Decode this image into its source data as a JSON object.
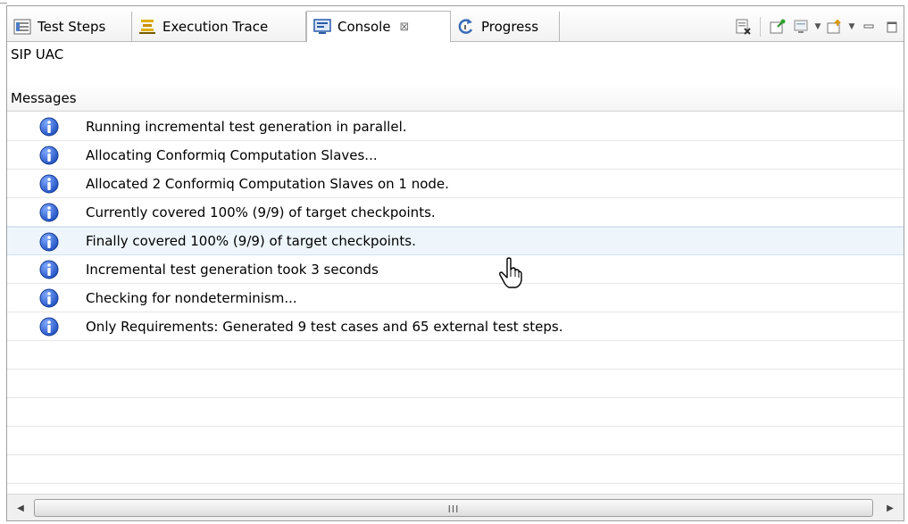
{
  "tabs": [
    {
      "label": "Test Steps",
      "icon": "test-steps-icon"
    },
    {
      "label": "Execution Trace",
      "icon": "execution-trace-icon"
    },
    {
      "label": "Console",
      "icon": "console-icon",
      "close": "⊠"
    },
    {
      "label": "Progress",
      "icon": "progress-icon"
    }
  ],
  "view": {
    "title": "SIP UAC"
  },
  "table": {
    "header": "Messages",
    "rows": [
      "Running incremental test generation in parallel.",
      "Allocating Conformiq Computation Slaves...",
      "Allocated 2 Conformiq Computation Slaves on 1 node.",
      "Currently covered 100% (9/9) of target checkpoints.",
      "Finally covered 100% (9/9) of target checkpoints.",
      "Incremental test generation took 3 seconds",
      "Checking for nondeterminism...",
      "Only Requirements: Generated 9 test cases and 65 external test steps."
    ]
  },
  "scrollbar": {
    "grip": "III",
    "left": "◀",
    "right": "▶"
  },
  "colors": {
    "info": "#1f4fbf",
    "highlight": "#eef6fc"
  }
}
